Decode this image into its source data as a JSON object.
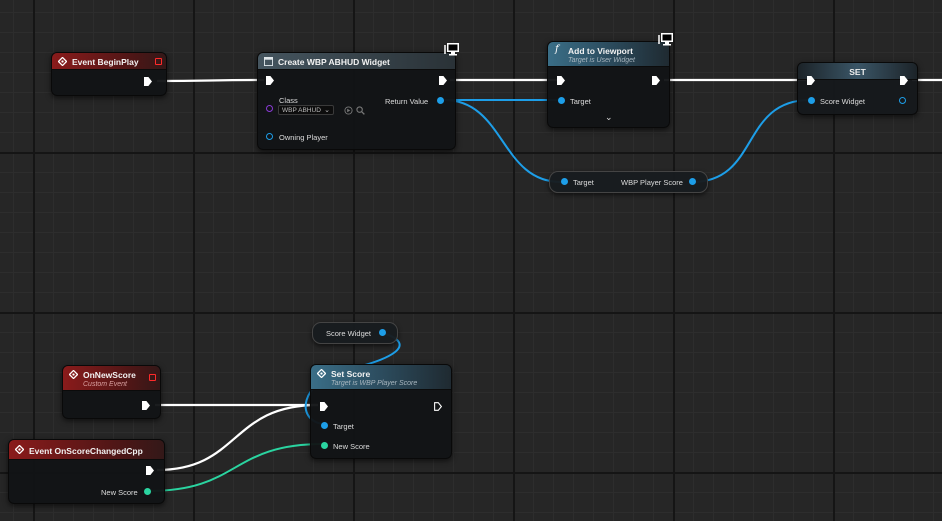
{
  "nodes": {
    "event_beginplay": {
      "title": "Event BeginPlay"
    },
    "create_widget": {
      "title": "Create WBP ABHUD Widget",
      "class_label": "Class",
      "class_value": "WBP ABHUD",
      "owning_player_label": "Owning Player",
      "return_value_label": "Return Value"
    },
    "add_to_viewport": {
      "title": "Add to Viewport",
      "subtitle": "Target is User Widget",
      "target_label": "Target"
    },
    "set_node": {
      "title": "SET",
      "score_widget_label": "Score Widget"
    },
    "get_player_score": {
      "target_label": "Target",
      "output_label": "WBP Player Score"
    },
    "score_widget_var": {
      "label": "Score Widget"
    },
    "on_new_score": {
      "title": "OnNewScore",
      "subtitle": "Custom Event"
    },
    "set_score": {
      "title": "Set Score",
      "subtitle": "Target is WBP Player Score",
      "target_label": "Target",
      "new_score_label": "New Score"
    },
    "event_score_changed": {
      "title": "Event OnScoreChangedCpp",
      "new_score_label": "New Score"
    }
  },
  "colors": {
    "exec_wire": "#ffffff",
    "object_pin": "#1d9ee8",
    "int_pin": "#2ad4a0",
    "class_pin": "#8a3ad6",
    "event_header": "#8a1b1b",
    "function_header": "#3a6e87"
  },
  "icons": [
    "event-diamond-icon",
    "widget-icon",
    "function-icon",
    "monitor-icon",
    "chevron-down-icon",
    "dropdown-arrow-icon",
    "browse-icon",
    "search-icon"
  ]
}
